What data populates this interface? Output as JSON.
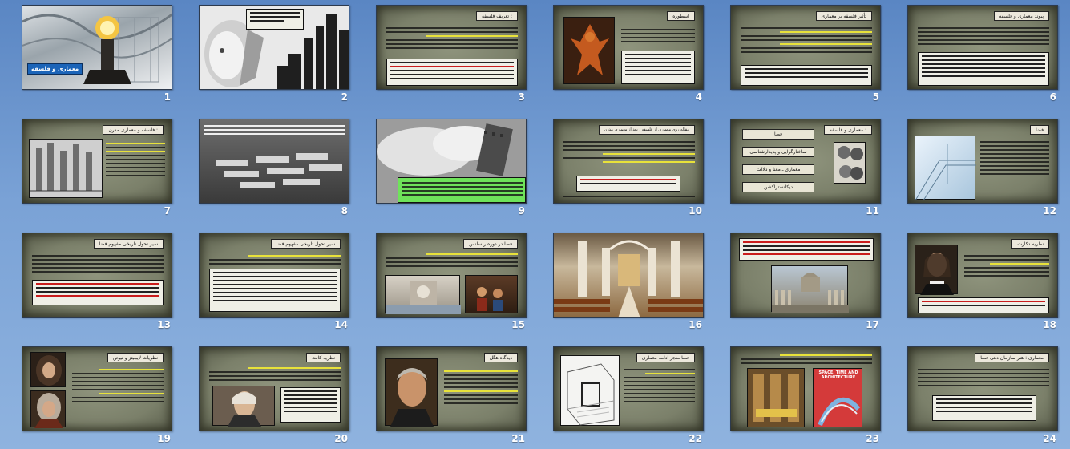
{
  "slides": [
    {
      "num": "1",
      "caption": "معماری و فلسفه"
    },
    {
      "num": "2"
    },
    {
      "num": "3",
      "title": "تعریف فلسفه :"
    },
    {
      "num": "4",
      "title": "اسطوره"
    },
    {
      "num": "5",
      "title": "تأثیر فلسفه بر معماری"
    },
    {
      "num": "6",
      "title": "پیوند معماری و فلسفه"
    },
    {
      "num": "7",
      "title": "فلسفه و معماری مدرن :"
    },
    {
      "num": "8"
    },
    {
      "num": "9"
    },
    {
      "num": "10",
      "title": "مقاله روی معماری از فلسفه ، بعد از معماری مدرن"
    },
    {
      "num": "11",
      "title": "معماری و فلسفه :",
      "buttons": [
        "فضا",
        "ساختارگرایی و پدیدارشناسی",
        "معماری ـ معنا و دلالت",
        "دیکانستراکشن"
      ]
    },
    {
      "num": "12",
      "title": "فضا"
    },
    {
      "num": "13",
      "title": "سیر تحول تاریخی مفهوم فضا"
    },
    {
      "num": "14",
      "title": "سیر تحول تاریخی مفهوم فضا"
    },
    {
      "num": "15",
      "title": "فضا در دوره رنسانس"
    },
    {
      "num": "16"
    },
    {
      "num": "17"
    },
    {
      "num": "18",
      "title": "نظریه دکارت"
    },
    {
      "num": "19",
      "title": "نظریات لایبنیتز و نیوتن"
    },
    {
      "num": "20",
      "title": "نظریه کانت"
    },
    {
      "num": "21",
      "title": "دیدگاه هگل"
    },
    {
      "num": "22",
      "title": "فضا منجر ادامه معماری"
    },
    {
      "num": "23",
      "book": "SPACE, TIME AND ARCHITECTURE"
    },
    {
      "num": "24",
      "title": "معماری : هنر سازمان دهی فضا"
    }
  ]
}
